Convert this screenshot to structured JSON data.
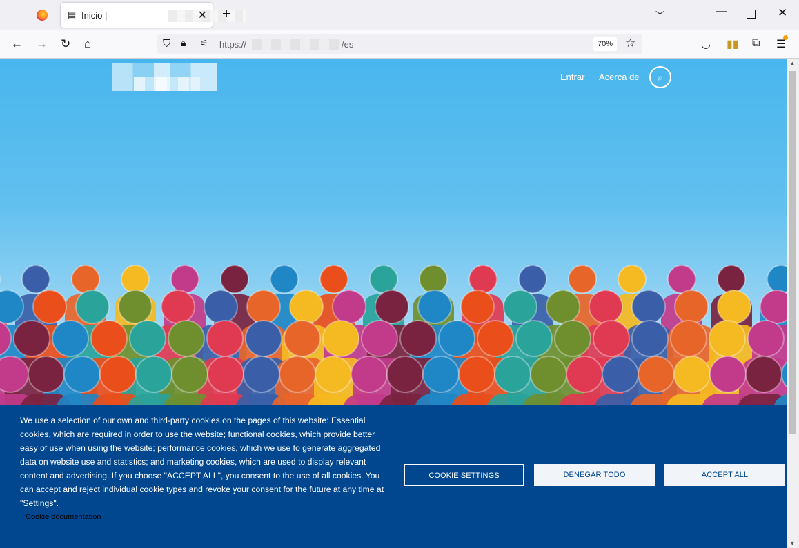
{
  "browser": {
    "tab_title": "Inicio |",
    "url_prefix": "https://",
    "url_suffix": "/es",
    "zoom": "70%"
  },
  "site": {
    "nav": {
      "login": "Entrar",
      "about": "Acerca de"
    }
  },
  "cookie_banner": {
    "text": "We use a selection of our own and third-party cookies on the pages of this website: Essential cookies, which are required in order to use the website; functional cookies, which provide better easy of use when using the website; performance cookies, which we use to generate aggregated data on website use and statistics; and marketing cookies, which are used to display relevant content and advertising. If you choose \"ACCEPT ALL\", you consent to the use of all cookies. You can accept and reject individual cookie types and revoke your consent for the future at any time at \"Settings\".",
    "doc_link": "Cookie documentation",
    "settings_label": "COOKIE SETTINGS",
    "deny_label": "DENEGAR TODO",
    "accept_label": "ACCEPT ALL"
  },
  "colors": {
    "banner_bg": "#00478f",
    "sky_top": "#48b6ee",
    "figures": [
      "#e03a52",
      "#f5b921",
      "#1f87c5",
      "#6f8f2f",
      "#e8652a",
      "#7a2340",
      "#2aa39a",
      "#3a5fa8",
      "#c23a8a",
      "#e94e1b"
    ]
  }
}
